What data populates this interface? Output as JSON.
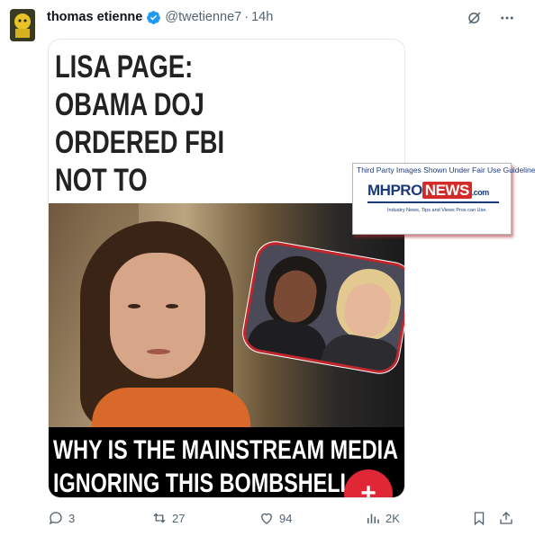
{
  "author": {
    "display_name": "thomas etienne",
    "handle": "@twetienne7",
    "separator": "·",
    "time": "14h",
    "verified": true
  },
  "header_icons": [
    "grok-icon",
    "more-icon"
  ],
  "media": {
    "headline": "LISA PAGE: OBAMA DOJ ORDERED FBI NOT TO PROSECUTE HILLARY CLINTON",
    "bottom_text_line1": "WHY IS THE MAINSTREAM MEDIA",
    "bottom_text_line2": "IGNORING THIS BOMBSHELL?",
    "fab_symbol": "+"
  },
  "watermark": {
    "top_line": "Third Party Images Shown Under Fair Use Guidelines",
    "logo_mh": "MH",
    "logo_pro": "PRO",
    "logo_news": "NEWS",
    "logo_com": ".com",
    "tagline": "Industry News, Tips and Views Pros can Use."
  },
  "actions": {
    "replies": "3",
    "reposts": "27",
    "likes": "94",
    "views": "2K"
  },
  "colors": {
    "verified": "#1d9bf0",
    "muted": "#536471",
    "accent_red": "#e02736"
  }
}
